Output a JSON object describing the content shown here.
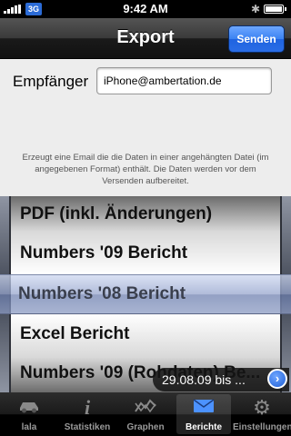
{
  "status_bar": {
    "network": "3G",
    "time": "9:42 AM"
  },
  "nav": {
    "title": "Export",
    "send_label": "Senden"
  },
  "form": {
    "recipient_label": "Empfänger",
    "recipient_value": "iPhone@ambertation.de",
    "info": "Erzeugt eine Email die die Daten in einer angehängten Datei (im angegebenen Format) enthält. Die Daten werden vor dem Versenden aufbereitet."
  },
  "picker": {
    "options": [
      "PDF (inkl. Änderungen)",
      "Numbers '09 Bericht",
      "Numbers '08 Bericht",
      "Excel Bericht",
      "Numbers '09 (Rohdaten) Be..."
    ],
    "selected": "Numbers '08 Bericht"
  },
  "date_range": {
    "label": "29.08.09 bis ..."
  },
  "tabs": [
    {
      "label": "lala",
      "icon": "car-icon"
    },
    {
      "label": "Statistiken",
      "icon": "info-icon"
    },
    {
      "label": "Graphen",
      "icon": "graph-icon"
    },
    {
      "label": "Berichte",
      "icon": "envelope-icon",
      "active": true
    },
    {
      "label": "Einstellungen",
      "icon": "gear-icon"
    }
  ],
  "colors": {
    "accent": "#2a6de6",
    "active_tab_icon": "#4c92ff"
  }
}
